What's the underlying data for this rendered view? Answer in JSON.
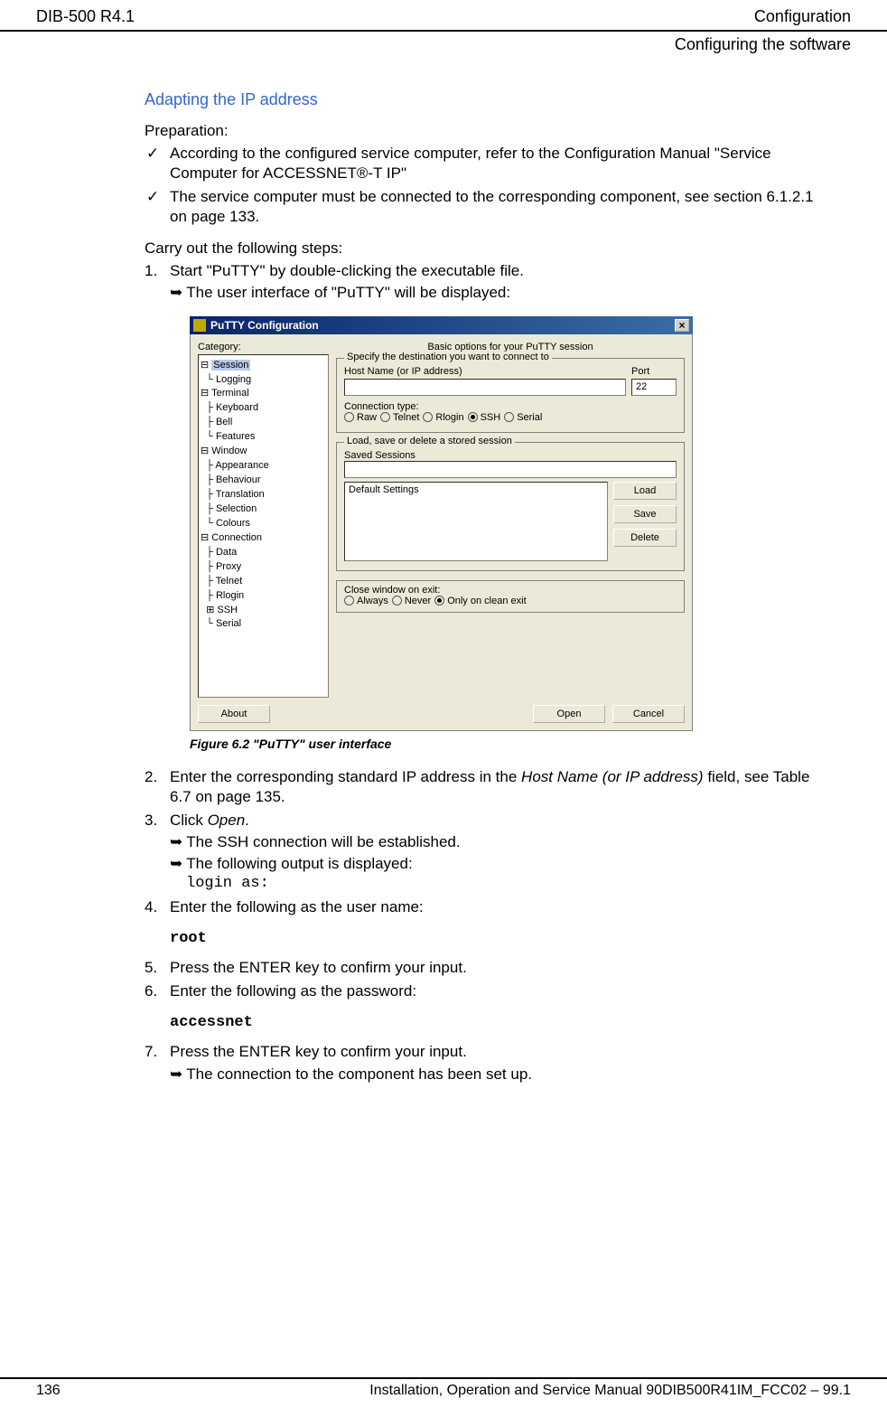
{
  "header": {
    "left": "DIB-500 R4.1",
    "right": "Configuration",
    "sub": "Configuring the software"
  },
  "section": {
    "title": "Adapting the IP address",
    "prep_label": "Preparation:",
    "checks": [
      "According to the configured service computer, refer to the Configuration Manual \"Service Computer for ACCESSNET®-T IP\"",
      "The service computer must be connected to the corresponding component, see section 6.1.2.1 on page 133."
    ],
    "carry_label": "Carry out the following steps:",
    "step1": "Start \"PuTTY\" by double-clicking the executable file.",
    "step1_arrow": "The user interface of \"PuTTY\" will be displayed:",
    "fig_caption": "Figure 6.2 \"PuTTY\" user interface",
    "step2a": "Enter the corresponding standard IP address in the ",
    "step2b": "Host Name (or IP address)",
    "step2c": " field, see Table 6.7 on page 135.",
    "step3a": "Click ",
    "step3b": "Open",
    "step3c": ".",
    "step3_arrow1": "The SSH connection will be established.",
    "step3_arrow2": "The following output is displayed:",
    "step3_code": "login as:",
    "step4": "Enter the following as the user name:",
    "step4_code": "root",
    "step5": "Press the ENTER key to confirm your input.",
    "step6": "Enter the following as the password:",
    "step6_code": "accessnet",
    "step7": "Press the ENTER key to confirm your input.",
    "step7_arrow": "The connection to the component has been set up."
  },
  "putty": {
    "title": "PuTTY Configuration",
    "category_label": "Category:",
    "tree": {
      "session": "Session",
      "logging": "Logging",
      "terminal": "Terminal",
      "keyboard": "Keyboard",
      "bell": "Bell",
      "features": "Features",
      "window": "Window",
      "appearance": "Appearance",
      "behaviour": "Behaviour",
      "translation": "Translation",
      "selection": "Selection",
      "colours": "Colours",
      "connection": "Connection",
      "data": "Data",
      "proxy": "Proxy",
      "telnet": "Telnet",
      "rlogin": "Rlogin",
      "ssh": "SSH",
      "serial": "Serial"
    },
    "main_title": "Basic options for your PuTTY session",
    "group1": {
      "legend": "Specify the destination you want to connect to",
      "host_label": "Host Name (or IP address)",
      "port_label": "Port",
      "port_value": "22",
      "conn_type": "Connection type:",
      "raw": "Raw",
      "telnet": "Telnet",
      "rlogin": "Rlogin",
      "ssh": "SSH",
      "serial": "Serial"
    },
    "group2": {
      "legend": "Load, save or delete a stored session",
      "saved_label": "Saved Sessions",
      "default": "Default Settings",
      "load": "Load",
      "save": "Save",
      "delete": "Delete"
    },
    "group3": {
      "close_label": "Close window on exit:",
      "always": "Always",
      "never": "Never",
      "clean": "Only on clean exit"
    },
    "about": "About",
    "open": "Open",
    "cancel": "Cancel"
  },
  "footer": {
    "page": "136",
    "text": "Installation, Operation and Service Manual 90DIB500R41IM_FCC02 – 99.1"
  }
}
